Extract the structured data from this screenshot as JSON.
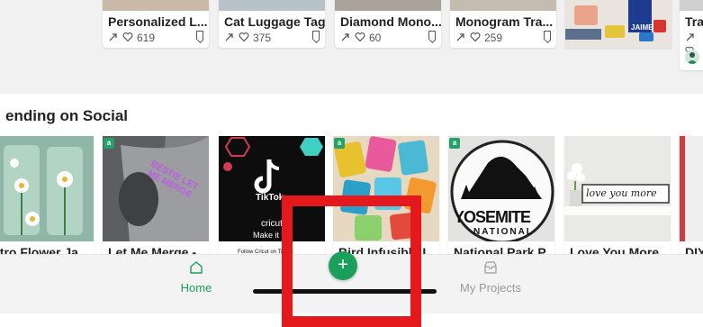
{
  "top_cards": [
    {
      "title": "Personalized L...",
      "likes": "619"
    },
    {
      "title": "Cat Luggage Tag",
      "likes": "375"
    },
    {
      "title": "Diamond Mono...",
      "likes": "60"
    },
    {
      "title": "Monogram Tra...",
      "likes": "259"
    }
  ],
  "partial_top_title": "Tra",
  "top_image_text": "JAIME",
  "section_title": "ending on Social",
  "social_cards": [
    {
      "label": "etro Flower Ja..."
    },
    {
      "label": "Let Me Merge -..."
    },
    {
      "label": ""
    },
    {
      "label": "Bird Infusible I..."
    },
    {
      "label": "National Park P..."
    },
    {
      "label": "Love You More..."
    },
    {
      "label": "DIY"
    }
  ],
  "card_image_texts": {
    "tiktok": "TikTok",
    "cricut": "cricut",
    "make_it": "Make it f",
    "follow": "Follow Cricut on TikTok",
    "yosemite": "YOSEMITE",
    "national": "NATIONAL",
    "love_sign": "love you more",
    "bestie": "BESTIE LET ME MERGE"
  },
  "bottom_nav": {
    "home_label": "Home",
    "projects_label": "My Projects",
    "fab_label": "+"
  },
  "colors": {
    "accent": "#1aa05a",
    "highlight": "#e5191c",
    "inactive": "#9a9a9a"
  }
}
